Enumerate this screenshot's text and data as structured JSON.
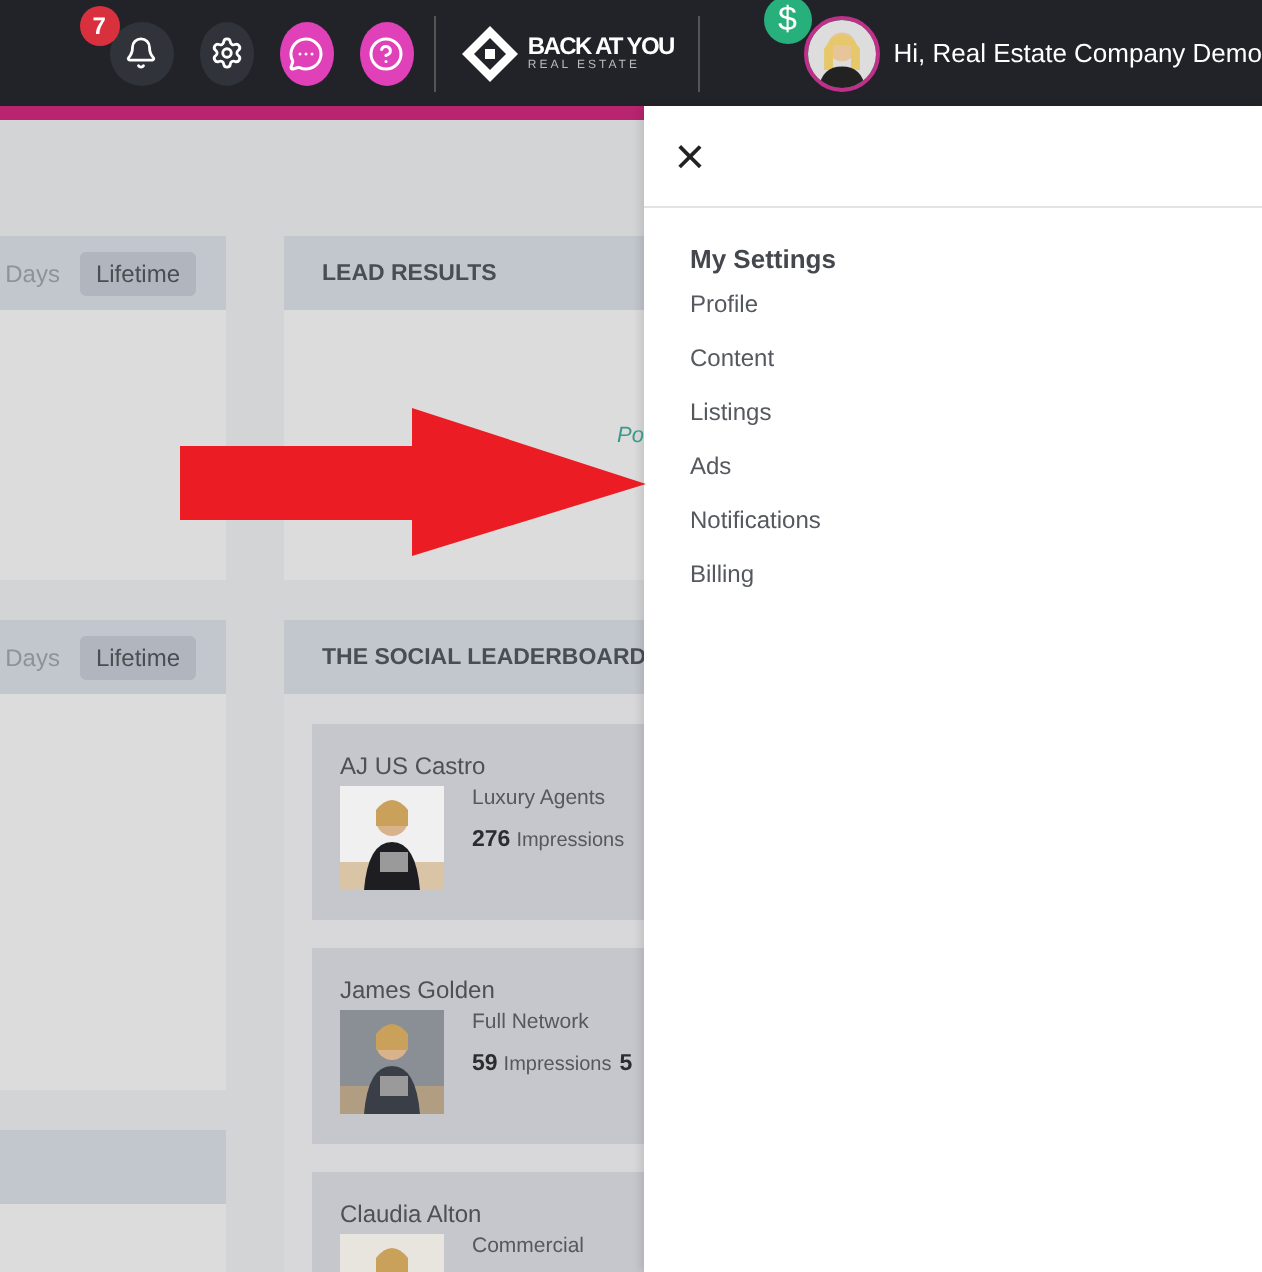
{
  "topbar": {
    "notification_count": "7",
    "logo": {
      "title": "BACK AT YOU",
      "subtitle": "REAL ESTATE"
    },
    "dollar_badge": "$",
    "greeting": "Hi, Real Estate Company Demo"
  },
  "left_cards": [
    {
      "kind": "filtered",
      "filters": [
        "Days",
        "Lifetime"
      ]
    },
    {
      "kind": "filtered",
      "filters": [
        "Days",
        "Lifetime"
      ]
    },
    {
      "kind": "blank"
    }
  ],
  "lead_results": {
    "title": "LEAD RESULTS",
    "fragment": "Po"
  },
  "leaderboard": {
    "title": "THE SOCIAL LEADERBOARD",
    "entries": [
      {
        "name": "AJ US Castro",
        "category": "Luxury Agents",
        "count": "276",
        "unit": "Impressions"
      },
      {
        "name": "James Golden",
        "category": "Full Network",
        "count": "59",
        "unit": "Impressions",
        "extra": "5"
      },
      {
        "name": "Claudia Alton",
        "category": "Commercial"
      }
    ]
  },
  "settings_panel": {
    "close": "×",
    "heading": "My Settings",
    "items": [
      "Profile",
      "Content",
      "Listings",
      "Ads",
      "Notifications",
      "Billing"
    ]
  }
}
